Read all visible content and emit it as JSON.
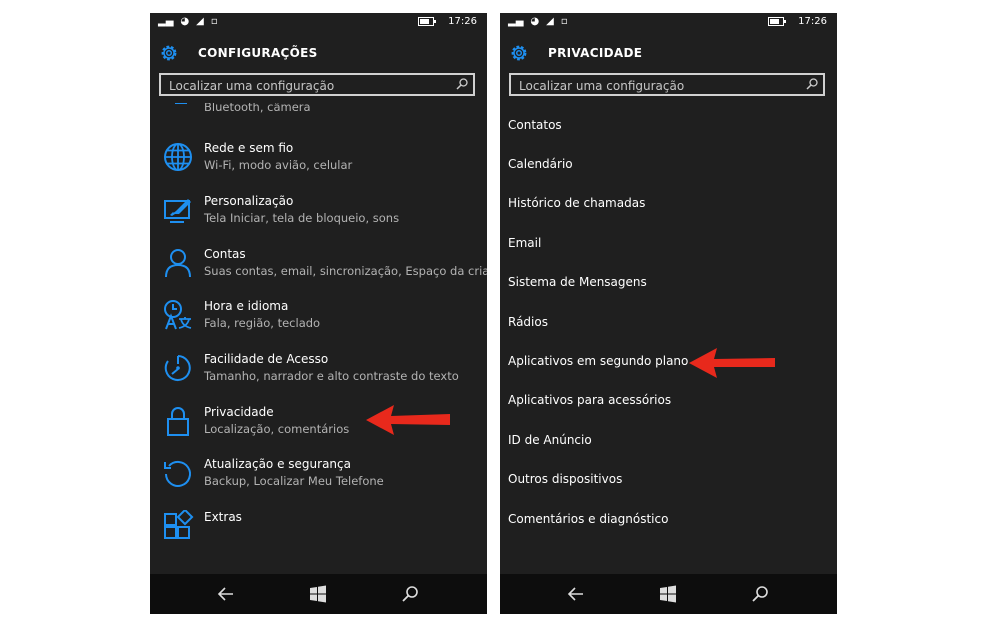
{
  "status_bar": {
    "time": "17:26",
    "battery_level": 0.6
  },
  "left_screen": {
    "title": "CONFIGURAÇÕES",
    "search_placeholder": "Localizar uma configuração",
    "partial_item_subtitle": "Bluetooth, câmera",
    "items": [
      {
        "title": "Rede e sem fio",
        "subtitle": "Wi-Fi, modo avião, celular",
        "icon": "globe-icon"
      },
      {
        "title": "Personalização",
        "subtitle": "Tela Iniciar, tela de bloqueio, sons",
        "icon": "personalization-icon"
      },
      {
        "title": "Contas",
        "subtitle": "Suas contas, email, sincronização, Espaço da criança",
        "icon": "person-icon"
      },
      {
        "title": "Hora e idioma",
        "subtitle": "Fala, região, teclado",
        "icon": "time-language-icon"
      },
      {
        "title": "Facilidade de Acesso",
        "subtitle": "Tamanho, narrador e alto contraste do texto",
        "icon": "ease-of-access-icon"
      },
      {
        "title": "Privacidade",
        "subtitle": "Localização, comentários",
        "icon": "lock-icon"
      },
      {
        "title": "Atualização e segurança",
        "subtitle": "Backup, Localizar Meu Telefone",
        "icon": "update-icon"
      },
      {
        "title": "Extras",
        "subtitle": "",
        "icon": "extras-icon"
      }
    ]
  },
  "right_screen": {
    "title": "PRIVACIDADE",
    "search_placeholder": "Localizar uma configuração",
    "items": [
      "Contatos",
      "Calendário",
      "Histórico de chamadas",
      "Email",
      "Sistema de Mensagens",
      "Rádios",
      "Aplicativos em segundo plano",
      "Aplicativos para acessórios",
      "ID de Anúncio",
      "Outros dispositivos",
      "Comentários e diagnóstico"
    ]
  },
  "colors": {
    "accent": "#1e8ff0",
    "arrow": "#e8291c",
    "background": "#1f1f1f",
    "navbar": "#0d0d0d"
  }
}
